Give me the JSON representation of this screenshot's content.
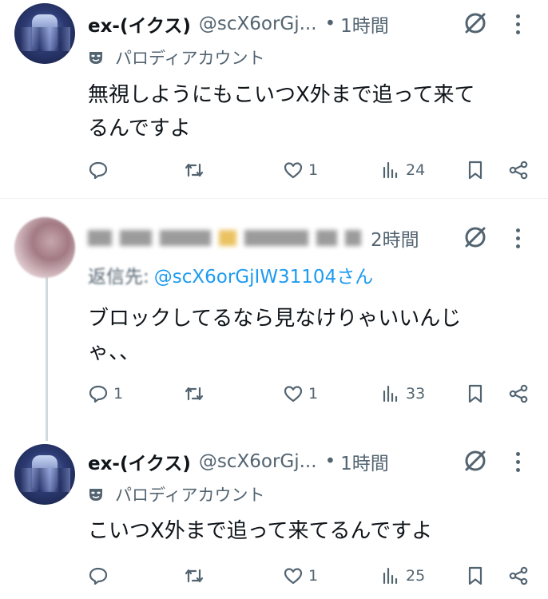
{
  "tweets": [
    {
      "name": "ex-(イクス)",
      "handle": "@scX6orGj...",
      "time": "1時間",
      "parody_label": "パロディアカウント",
      "text_lines": [
        "無視しようにもこいつX外まで追って来て",
        "るんですよ"
      ],
      "replies": "",
      "likes": "1",
      "views": "24"
    },
    {
      "time": "2時間",
      "reply_label": "返信先:",
      "reply_handle": "@scX6orGjIW31104さん",
      "text_lines": [
        "ブロックしてるなら見なけりゃいいんじ",
        "ゃ、、"
      ],
      "replies": "1",
      "likes": "1",
      "views": "33"
    },
    {
      "name": "ex-(イクス)",
      "handle": "@scX6orGj...",
      "time": "1時間",
      "parody_label": "パロディアカウント",
      "text_lines": [
        "こいつX外まで追って来てるんですよ"
      ],
      "replies": "",
      "likes": "1",
      "views": "25"
    }
  ],
  "colors": {
    "text": "#0f1419",
    "muted": "#536471",
    "link": "#1d9bf0",
    "divider": "#eff3f4"
  }
}
